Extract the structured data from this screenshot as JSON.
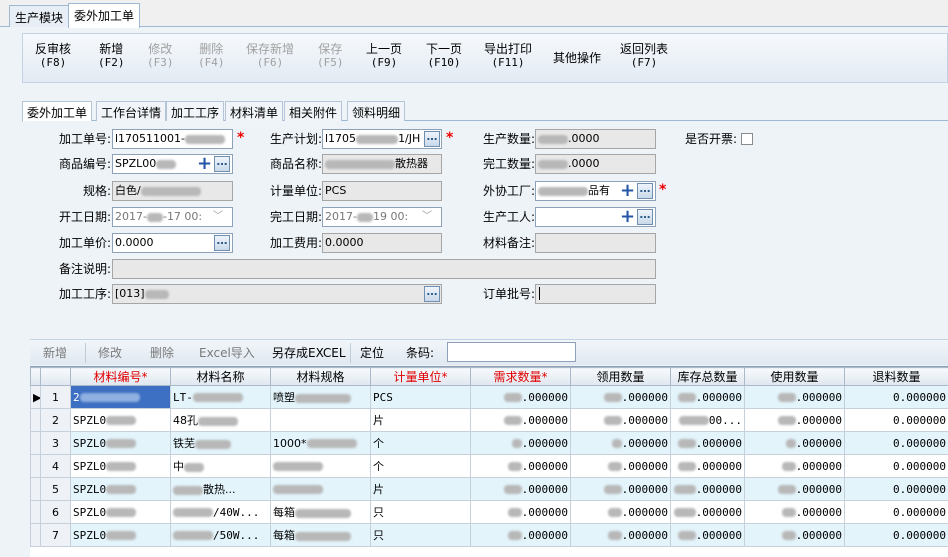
{
  "top_tabs": [
    "生产模块",
    "委外加工单"
  ],
  "toolbar": [
    {
      "label": "反审核",
      "key": "(F8)",
      "enabled": true
    },
    {
      "label": "新增",
      "key": "(F2)",
      "enabled": true
    },
    {
      "label": "修改",
      "key": "(F3)",
      "enabled": false
    },
    {
      "label": "删除",
      "key": "(F4)",
      "enabled": false
    },
    {
      "label": "保存新增",
      "key": "(F6)",
      "enabled": false
    },
    {
      "label": "保存",
      "key": "(F5)",
      "enabled": false
    },
    {
      "label": "上一页",
      "key": "(F9)",
      "enabled": true
    },
    {
      "label": "下一页",
      "key": "(F10)",
      "enabled": true
    },
    {
      "label": "导出打印",
      "key": "(F11)",
      "enabled": true
    },
    {
      "label": "其他操作",
      "key": "",
      "enabled": true
    },
    {
      "label": "返回列表",
      "key": "(F7)",
      "enabled": true
    }
  ],
  "inner_tabs": [
    "委外加工单",
    "工作台详情",
    "加工工序",
    "材料清单",
    "相关附件",
    "领料明细"
  ],
  "form": {
    "order_no_label": "加工单号:",
    "order_no": "l170511001-",
    "plan_label": "生产计划:",
    "plan": "l1705",
    "plan_suffix": "1/JH",
    "qty_label": "生产数量:",
    "qty_suffix": ".0000",
    "invoice_label": "是否开票:",
    "product_code_label": "商品编号:",
    "product_code": "SPZL00",
    "product_name_label": "商品名称:",
    "product_name_suffix": "散热器",
    "done_qty_label": "完工数量:",
    "done_qty_suffix": ".0000",
    "spec_label": "规格:",
    "spec": "白色/",
    "unit_label": "计量单位:",
    "unit": "PCS",
    "factory_label": "外协工厂:",
    "factory_suffix": "品有",
    "start_date_label": "开工日期:",
    "start_date": "2017-",
    "start_date_suffix": "-17 00:",
    "done_date_label": "完工日期:",
    "done_date": "2017-",
    "done_date_suffix": "19 00:",
    "worker_label": "生产工人:",
    "price_label": "加工单价:",
    "price": "0.0000",
    "fee_label": "加工费用:",
    "fee": "0.0000",
    "material_note_label": "材料备注:",
    "remark_label": "备注说明:",
    "process_label": "加工工序:",
    "process": "[013]",
    "batch_label": "订单批号:"
  },
  "grid_toolbar": {
    "add": "新增",
    "edit": "修改",
    "delete": "删除",
    "excel_import": "Excel导入",
    "save_excel": "另存成EXCEL",
    "locate": "定位",
    "barcode_label": "条码:"
  },
  "columns": [
    {
      "label": "",
      "required": false
    },
    {
      "label": "",
      "required": false
    },
    {
      "label": "材料编号*",
      "required": true
    },
    {
      "label": "材料名称",
      "required": false
    },
    {
      "label": "材料规格",
      "required": false
    },
    {
      "label": "计量单位*",
      "required": true
    },
    {
      "label": "需求数量*",
      "required": true
    },
    {
      "label": "领用数量",
      "required": false
    },
    {
      "label": "库存总数量",
      "required": false
    },
    {
      "label": "使用数量",
      "required": false
    },
    {
      "label": "退料数量",
      "required": false
    }
  ],
  "rows": [
    {
      "n": "1",
      "code": "2",
      "name": "LT-",
      "spec": "喷塑",
      "unit": "PCS",
      "need": ".000000",
      "used": ".000000",
      "stock": ".000000",
      "use": ".000000",
      "ret": "0.000000"
    },
    {
      "n": "2",
      "code": "SPZL0",
      "name": "48孔",
      "spec": "",
      "unit": "片",
      "need": ".000000",
      "used": ".000000",
      "stock": "00...",
      "use": ".000000",
      "ret": "0.000000"
    },
    {
      "n": "3",
      "code": "SPZL0",
      "name": "铁芜",
      "spec": "1000*",
      "unit": "个",
      "need": ".000000",
      "used": ".000000",
      "stock": ".000000",
      "use": ".000000",
      "ret": "0.000000"
    },
    {
      "n": "4",
      "code": "SPZL0",
      "name": "中",
      "spec": "",
      "unit": "个",
      "need": ".000000",
      "used": ".000000",
      "stock": ".000000",
      "use": ".000000",
      "ret": "0.000000"
    },
    {
      "n": "5",
      "code": "SPZL0",
      "name": "散热...",
      "spec": "",
      "unit": "片",
      "need": ".000000",
      "used": ".000000",
      "stock": ".000000",
      "use": ".000000",
      "ret": "0.000000"
    },
    {
      "n": "6",
      "code": "SPZL0",
      "name": "/40W...",
      "spec": "每箱",
      "unit": "只",
      "need": ".000000",
      "used": ".000000",
      "stock": ".000000",
      "use": ".000000",
      "ret": "0.000000"
    },
    {
      "n": "7",
      "code": "SPZL0",
      "name": "/50W...",
      "spec": "每箱",
      "unit": "只",
      "need": ".000000",
      "used": ".000000",
      "stock": ".000000",
      "use": ".000000",
      "ret": "0.000000"
    }
  ],
  "row_pointer": "▶"
}
